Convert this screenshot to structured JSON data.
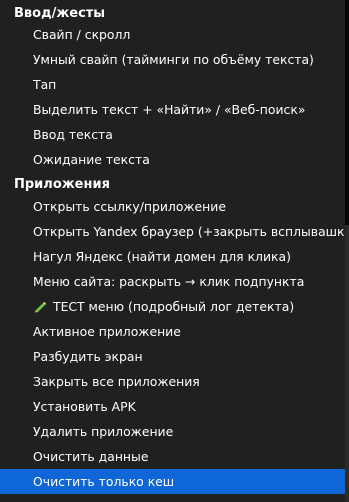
{
  "groups": [
    {
      "header": "Ввод/жесты",
      "items": [
        "Свайп / скролл",
        "Умный свайп (тайминги по объёму текста)",
        "Тап",
        "Выделить текст + «Найти» / «Веб-поиск»",
        "Ввод текста",
        "Ожидание текста"
      ]
    },
    {
      "header": "Приложения",
      "items": [
        "Открыть ссылку/приложение",
        "Открыть Yandex браузер (+закрыть всплывашки)",
        "Нагул Яндекс (найти домен для клика)",
        "Меню сайта: раскрыть → клик подпункта",
        "ТЕСТ меню (подробный лог детекта)",
        "Активное приложение",
        "Разбудить экран",
        "Закрыть все приложения",
        "Установить APK",
        "Удалить приложение",
        "Очистить данные",
        "Очистить только кеш"
      ]
    }
  ],
  "icons": {
    "test_menu_item": "pencil-icon"
  },
  "colors": {
    "menu_background": "#202020",
    "selected_background": "#0f66d6",
    "text": "#ffffff"
  }
}
